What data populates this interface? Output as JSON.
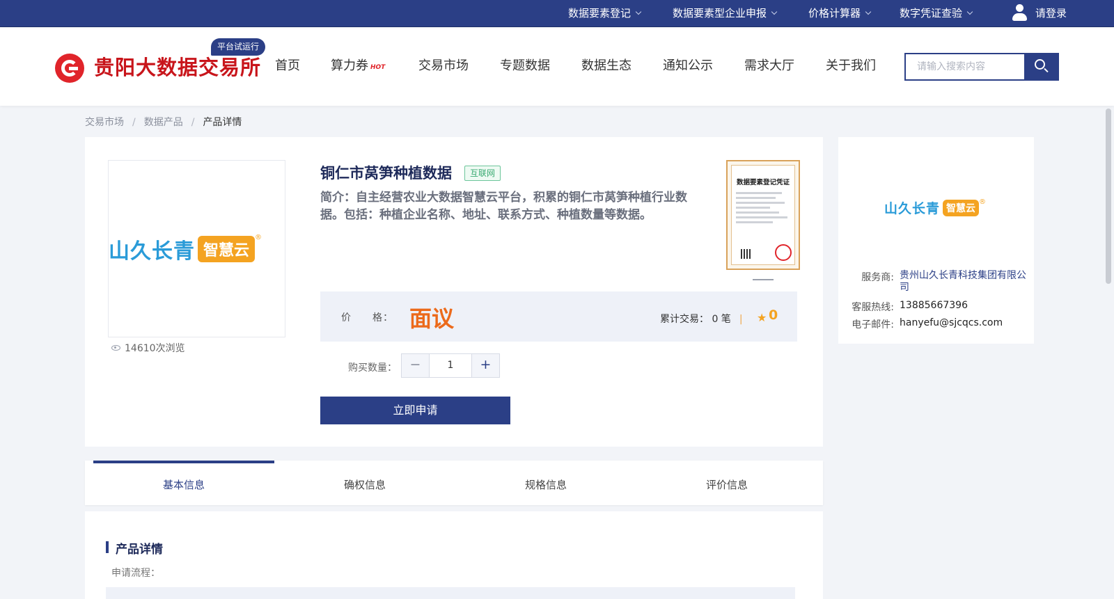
{
  "topbar": {
    "menu": [
      {
        "label": "数据要素登记"
      },
      {
        "label": "数据要素型企业申报"
      },
      {
        "label": "价格计算器"
      },
      {
        "label": "数字凭证查验"
      }
    ],
    "login_label": "请登录"
  },
  "header": {
    "logo_text": "贵阳大数据交易所",
    "trial_badge": "平台试运行",
    "nav": [
      "首页",
      "算力券",
      "交易市场",
      "专题数据",
      "数据生态",
      "通知公示",
      "需求大厅",
      "关于我们"
    ],
    "hot_tag": "HOT",
    "search_placeholder": "请输入搜索内容"
  },
  "breadcrumb": [
    "交易市场",
    "数据产品",
    "产品详情"
  ],
  "breadcrumb_sep": "/",
  "product": {
    "title": "铜仁市莴笋种植数据",
    "tag": "互联网",
    "description": "简介：自主经营农业大数据智慧云平台，积累的铜仁市莴笋种植行业数据。包括：种植企业名称、地址、联系方式、种植数量等数据。",
    "views": "14610次浏览",
    "brand_cn": "山久长青",
    "brand_pill": "智慧云",
    "brand_reg": "®",
    "certificate_title": "数据要素登记凭证",
    "price_label": "价　　格：",
    "price_value": "面议",
    "trade_label": "累计交易：",
    "trade_count": "0 笔",
    "trade_divider": "|",
    "rating": "0",
    "qty_label": "购买数量：",
    "qty_minus": "−",
    "qty_plus": "+",
    "quantity": "1",
    "apply_label": "立即申请"
  },
  "vendor": {
    "provider_label": "服务商:",
    "provider": "贵州山久长青科技集团有限公司",
    "hotline_label": "客服热线:",
    "hotline": "13885667396",
    "email_label": "电子邮件:",
    "email": "hanyefu@sjcqcs.com"
  },
  "tabs": [
    "基本信息",
    "确权信息",
    "规格信息",
    "评价信息"
  ],
  "details": {
    "section_title": "产品详情",
    "flow_label": "申请流程："
  },
  "colors": {
    "primary": "#2b3f86",
    "brand_red": "#c8151b",
    "price_orange": "#ec6a1b",
    "star": "#f4a321"
  }
}
